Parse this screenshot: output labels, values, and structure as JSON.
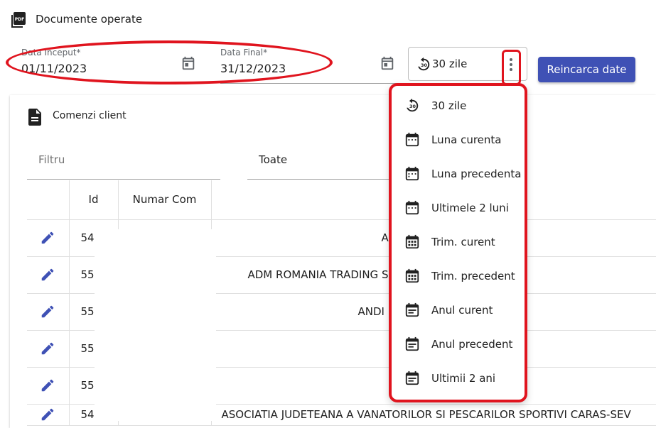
{
  "header": {
    "title": "Documente operate",
    "icon": "pdf-icon"
  },
  "filters": {
    "start_label": "Data Inceput*",
    "start_value": "01/11/2023",
    "end_label": "Data Final*",
    "end_value": "31/12/2023",
    "period_value": "30 zile",
    "reload_label": "Reincarca date"
  },
  "card": {
    "title": "Comenzi client",
    "filter_placeholder": "Filtru",
    "status_value": "Toate",
    "columns": [
      "",
      "Id",
      "Numar Com",
      ""
    ],
    "rows": [
      {
        "id": "54",
        "client": "AD"
      },
      {
        "id": "55",
        "client": "ADM ROMANIA TRADING S                                SONALITATE JURIDICA"
      },
      {
        "id": "55",
        "client": "ANDI                                    L."
      },
      {
        "id": "55",
        "client": ""
      },
      {
        "id": "55",
        "client": ""
      },
      {
        "id": "54",
        "client": "ASOCIATIA JUDETEANA A VANATORILOR SI PESCARILOR SPORTIVI CARAS-SEV"
      }
    ]
  },
  "menu": {
    "items": [
      {
        "label": "30 zile",
        "icon": "restore-30-icon"
      },
      {
        "label": "Luna curenta",
        "icon": "calendar-month-icon"
      },
      {
        "label": "Luna precedenta",
        "icon": "calendar-month-icon"
      },
      {
        "label": "Ultimele 2 luni",
        "icon": "calendar-month-icon"
      },
      {
        "label": "Trim. curent",
        "icon": "calendar-grid-icon"
      },
      {
        "label": "Trim. precedent",
        "icon": "calendar-grid-icon"
      },
      {
        "label": "Anul curent",
        "icon": "calendar-lines-icon"
      },
      {
        "label": "Anul precedent",
        "icon": "calendar-lines-icon"
      },
      {
        "label": "Ultimii 2 ani",
        "icon": "calendar-lines-icon"
      }
    ]
  },
  "colors": {
    "accent": "#3f51b5",
    "highlight": "#e0141e"
  }
}
